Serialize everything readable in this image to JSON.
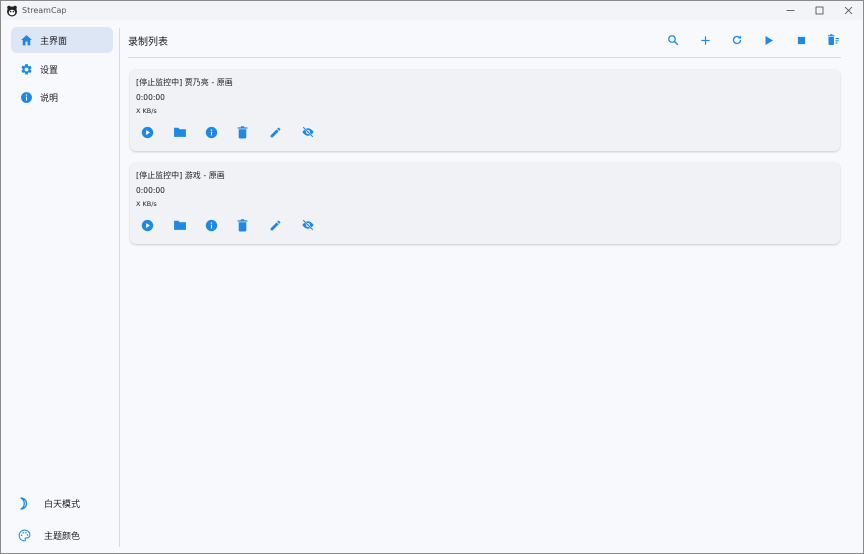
{
  "window": {
    "title": "StreamCap",
    "controls": [
      "minimize",
      "maximize",
      "close"
    ]
  },
  "sidebar": {
    "items": [
      {
        "label": "主界面",
        "icon": "home-icon",
        "active": true
      },
      {
        "label": "设置",
        "icon": "gear-icon",
        "active": false
      },
      {
        "label": "说明",
        "icon": "info-icon",
        "active": false
      }
    ],
    "bottom": [
      {
        "label": "白天模式",
        "icon": "moon-icon"
      },
      {
        "label": "主题颜色",
        "icon": "palette-icon"
      }
    ]
  },
  "main": {
    "title": "录制列表",
    "toolbar": [
      "search-icon",
      "add-icon",
      "refresh-icon",
      "play-icon",
      "stop-icon",
      "delete-sweep-icon"
    ]
  },
  "recordings": [
    {
      "title": "[停止监控中] 贾乃亮 - 原画",
      "duration": "0:00:00",
      "speed": "X KB/s",
      "actions": [
        "play-circle-icon",
        "folder-icon",
        "info-icon",
        "delete-icon",
        "edit-icon",
        "visibility-off-icon"
      ]
    },
    {
      "title": "[停止监控中] 游戏 - 原画",
      "duration": "0:00:00",
      "speed": "X KB/s",
      "actions": [
        "play-circle-icon",
        "folder-icon",
        "info-icon",
        "delete-icon",
        "edit-icon",
        "visibility-off-icon"
      ]
    }
  ],
  "colors": {
    "accent": "#1e88e5",
    "active_nav_bg": "#dde6f4",
    "card_bg": "#f1f2f6"
  }
}
